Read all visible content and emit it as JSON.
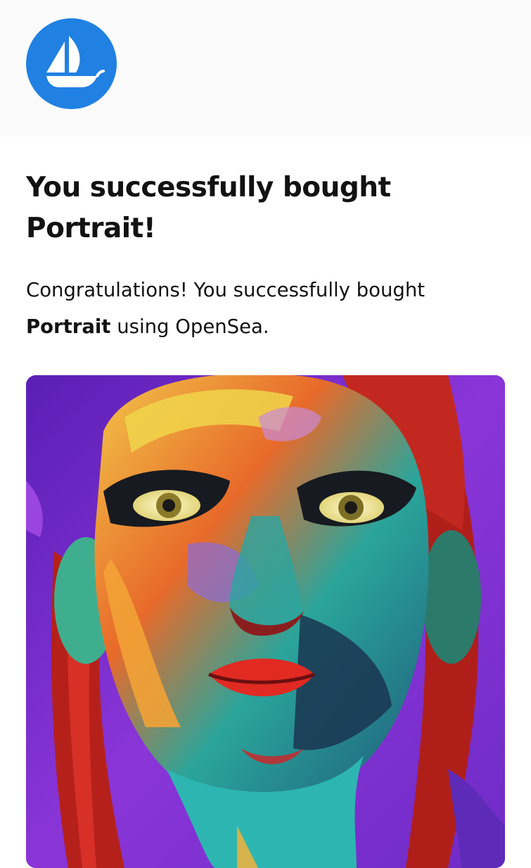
{
  "header": {
    "logo_icon": "opensea-ship-icon",
    "logo_color": "#2081e2"
  },
  "title": {
    "prefix": "You successfully bought",
    "item_name": "Portrait",
    "suffix": "!"
  },
  "message": {
    "prefix": "Congratulations! You successfully bought",
    "item_name": "Portrait",
    "suffix": "using OpenSea."
  },
  "artwork": {
    "icon": "colorful-portrait-painting",
    "background_color": "#7a2fd1"
  }
}
